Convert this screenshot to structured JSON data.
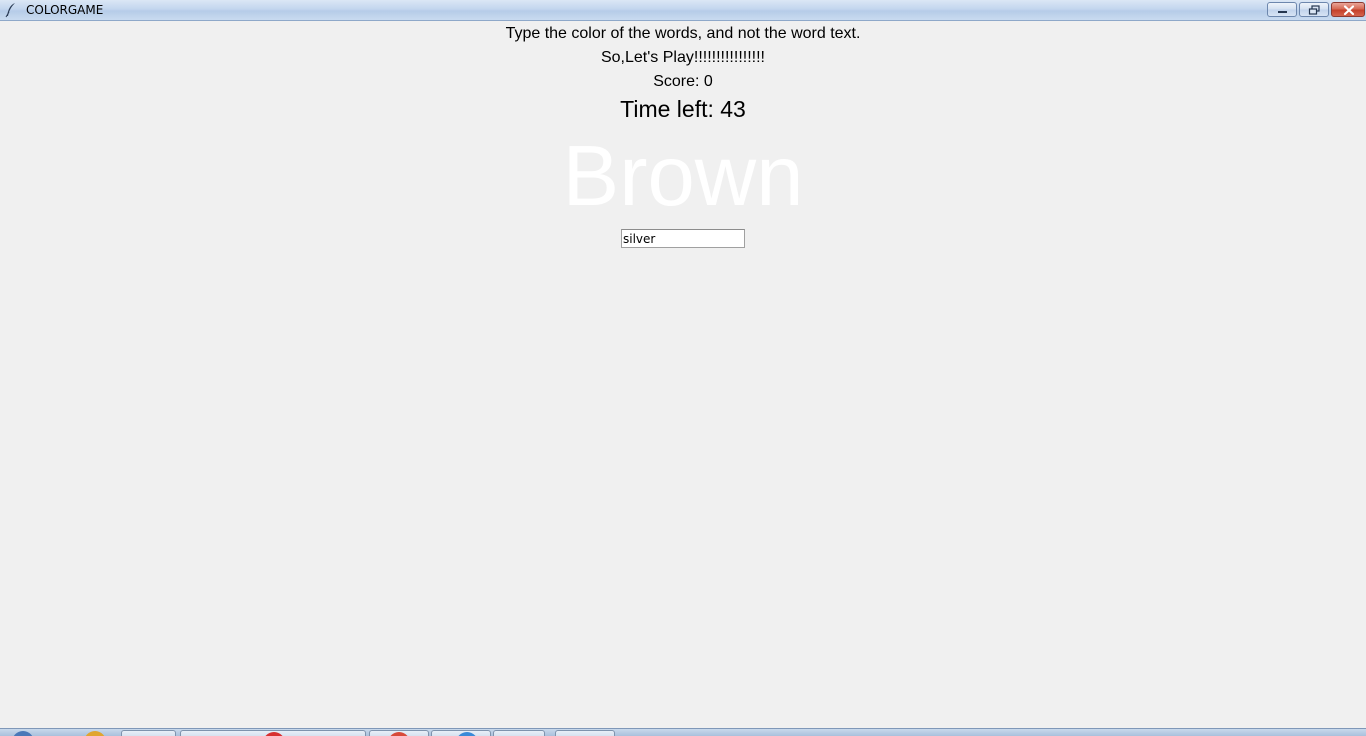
{
  "window": {
    "title": "COLORGAME",
    "minimize_icon": "minimize-icon",
    "maximize_icon": "restore-icon",
    "close_icon": "close-icon"
  },
  "game": {
    "instructions": "Type the color of the words, and not the word text.",
    "subtitle": "So,Let's Play!!!!!!!!!!!!!!!!",
    "score": "Score: 0",
    "time_left": "Time left: 43",
    "color_word": "Brown",
    "color_word_color": "#ffffff",
    "answer_value": "silver"
  },
  "colors": {
    "background": "#f0f0f0",
    "titlebar": "#c3d6ee",
    "close_button": "#c4402a"
  }
}
